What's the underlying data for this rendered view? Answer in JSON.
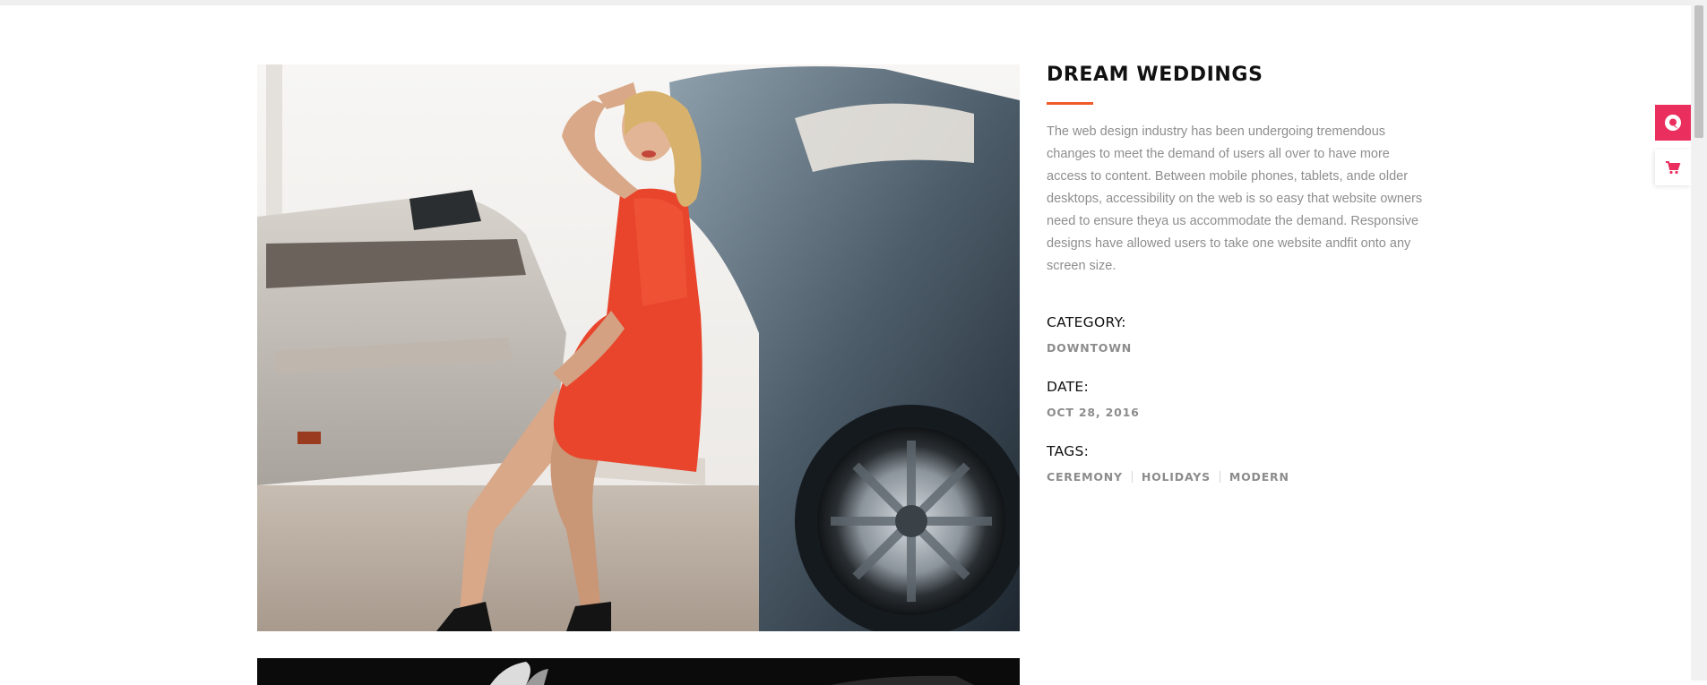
{
  "project": {
    "title": "DREAM WEDDINGS",
    "description": "The web design industry has been undergoing tremendous changes to meet the demand of users all over to have more access to content. Between mobile phones, tablets, ande older desktops, accessibility on the web is so easy that website owners need to ensure theya us accommodate the demand. Responsive designs have allowed users to take one website andfit onto any screen size.",
    "category_label": "CATEGORY:",
    "category_value": "DOWNTOWN",
    "date_label": "DATE:",
    "date_value": "OCT 28, 2016",
    "tags_label": "TAGS:",
    "tags": [
      "CEREMONY",
      "HOLIDAYS",
      "MODERN"
    ]
  },
  "images": {
    "main": "woman-in-red-dress-sitting-in-car-photo",
    "second": "black-car-photo"
  },
  "side_widgets": {
    "first_icon": "chat-icon",
    "second_icon": "cart-icon"
  },
  "colors": {
    "accent": "#f15a2a",
    "widget_pink": "#ea2e5e",
    "dress_red": "#e8452c",
    "text_muted": "#8e8e8e"
  }
}
